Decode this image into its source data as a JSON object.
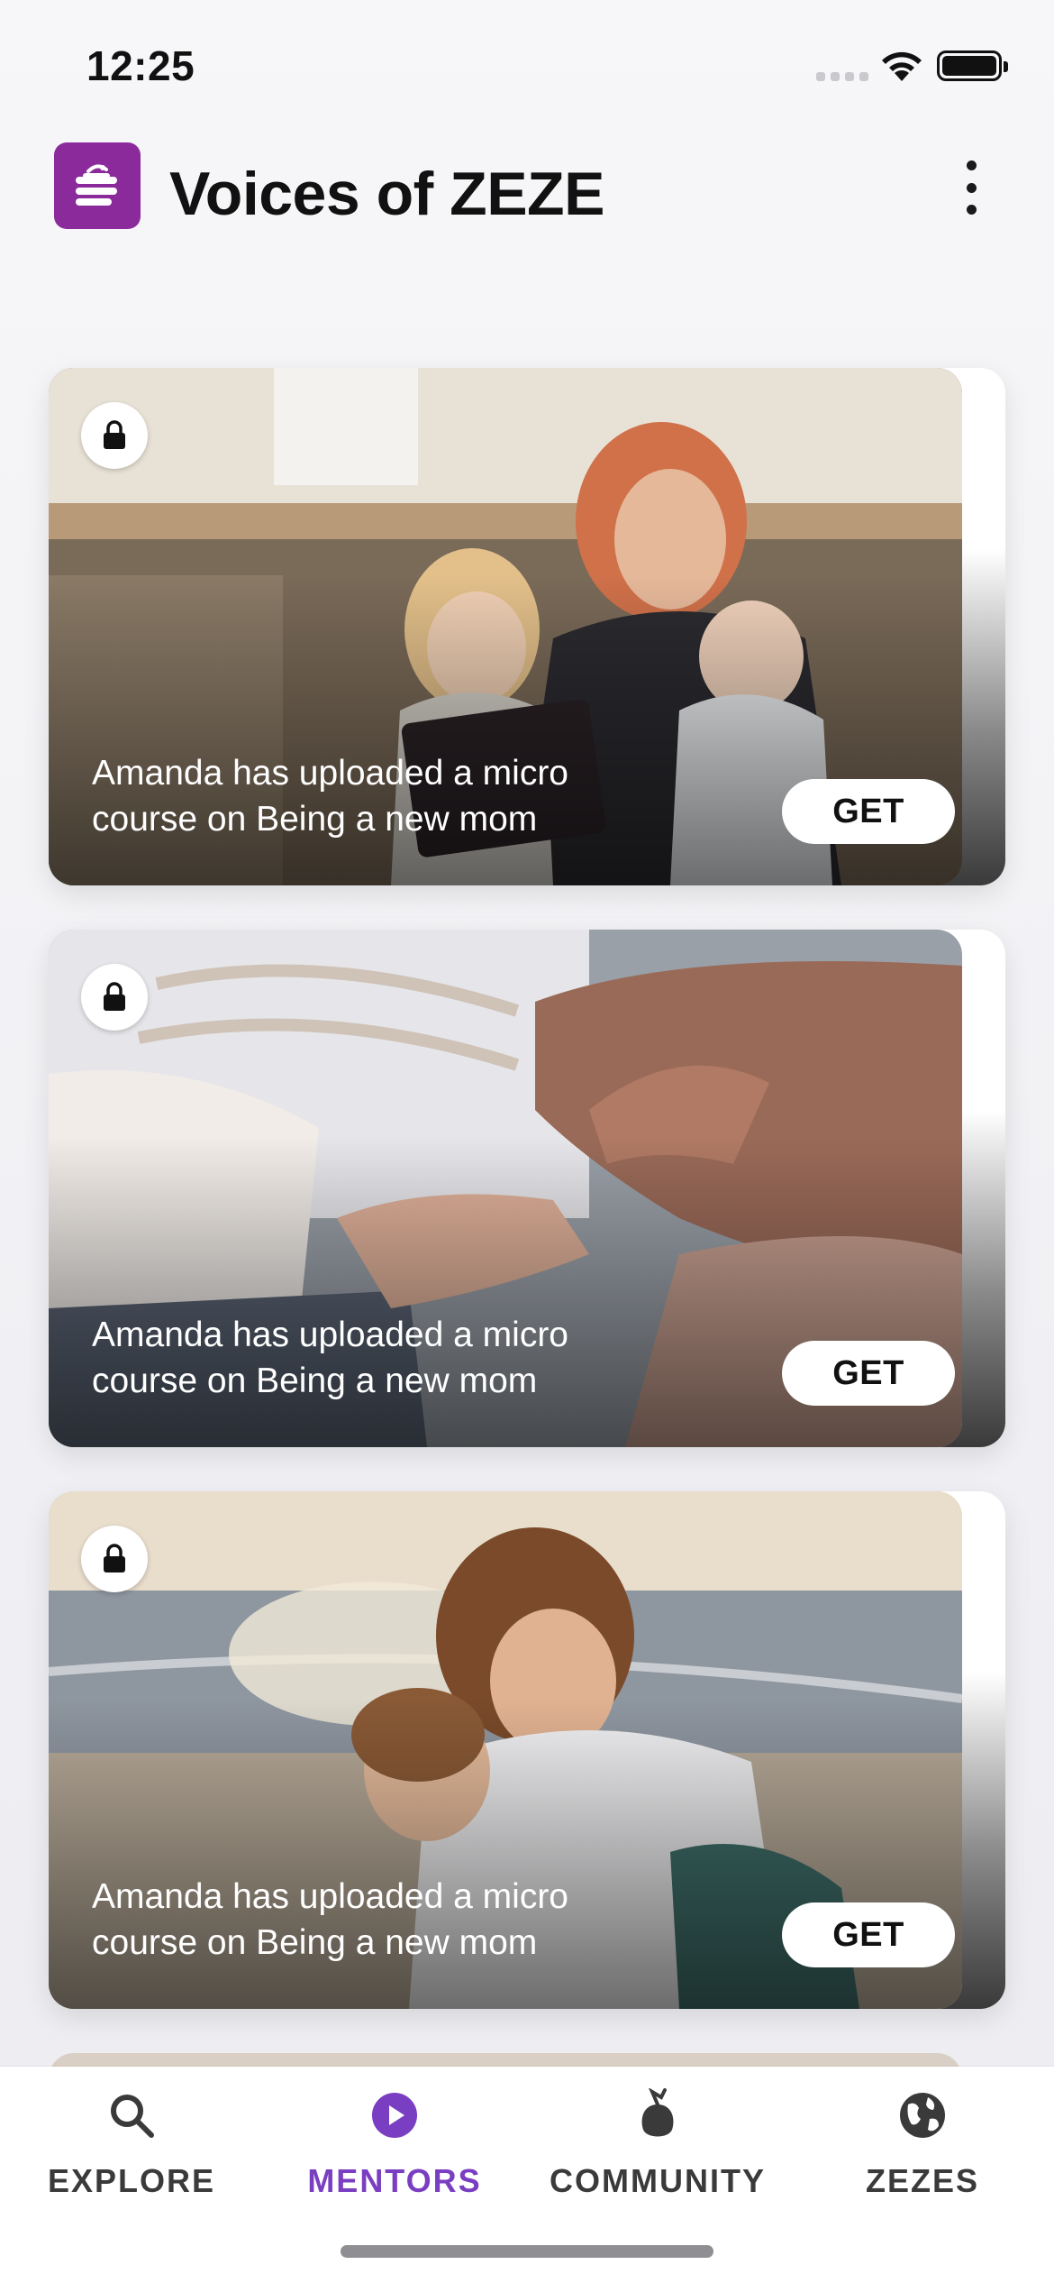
{
  "status_bar": {
    "time": "12:25"
  },
  "header": {
    "title": "Voices of ZEZE",
    "logo_icon": "zeze-logo-icon",
    "menu_icon": "more-vertical-icon"
  },
  "feed": {
    "cards": [
      {
        "text": "Amanda has uploaded a micro course on Being a new mom",
        "button": "GET",
        "locked": true,
        "image": "mother-with-two-children-on-sofa"
      },
      {
        "text": "Amanda has uploaded a micro course on Being a new mom",
        "button": "GET",
        "locked": true,
        "image": "baby-holding-adult-finger"
      },
      {
        "text": "Amanda has uploaded a micro course on Being a new mom",
        "button": "GET",
        "locked": true,
        "image": "mother-hugging-child-at-beach"
      }
    ]
  },
  "tabbar": {
    "tabs": [
      {
        "label": "EXPLORE",
        "icon": "search-icon",
        "active": false
      },
      {
        "label": "MENTORS",
        "icon": "play-circle-icon",
        "active": true
      },
      {
        "label": "COMMUNITY",
        "icon": "community-icon",
        "active": false
      },
      {
        "label": "ZEZES",
        "icon": "globe-icon",
        "active": false
      }
    ]
  },
  "colors": {
    "accent": "#7a3ec2",
    "logo_bg": "#8a2a9b"
  }
}
